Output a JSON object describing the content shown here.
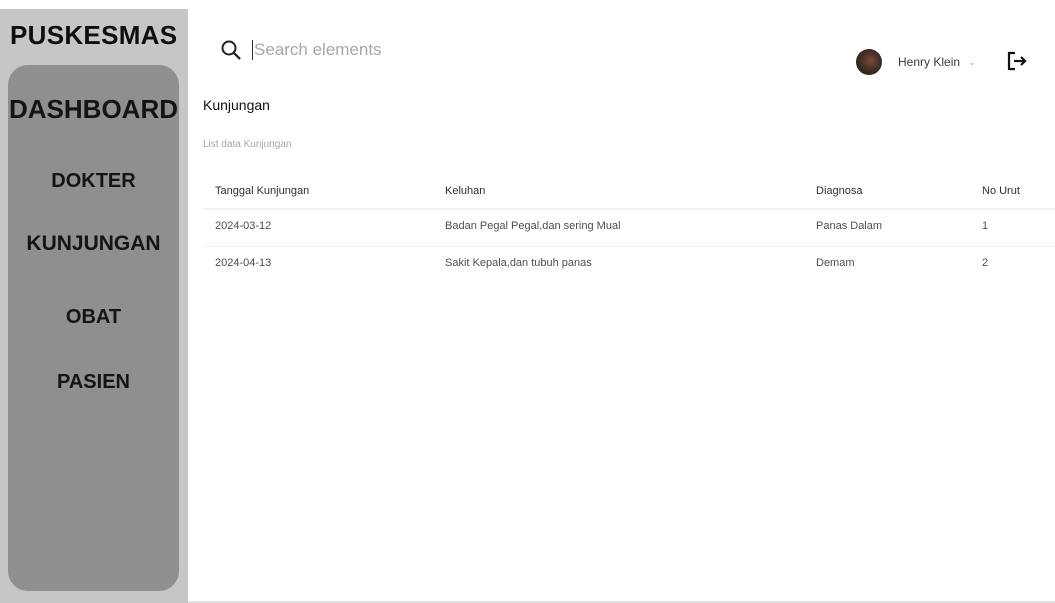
{
  "brand": "PUSKESMAS",
  "nav": {
    "dashboard": "DASHBOARD",
    "dokter": "DOKTER",
    "kunjungan": "KUNJUNGAN",
    "obat": "OBAT",
    "pasien": "PASIEN"
  },
  "search": {
    "placeholder": "Search elements",
    "icon": "search-icon"
  },
  "user": {
    "name": "Henry Klein",
    "avatar_icon": "avatar",
    "menu_icon": "chevron-down-icon",
    "logout_icon": "logout-icon"
  },
  "page": {
    "title": "Kunjungan",
    "subtitle": "List data Kunjungan"
  },
  "table": {
    "headers": [
      "Tanggal Kunjungan",
      "Keluhan",
      "Diagnosa",
      "No Urut"
    ],
    "rows": [
      [
        "2024-03-12",
        "Badan Pegal Pegal,dan sering Mual",
        "Panas Dalam",
        "1"
      ],
      [
        "2024-04-13",
        "Sakit Kepala,dan tubuh panas",
        "Demam",
        "2"
      ]
    ]
  },
  "colors": {
    "sidebar_outer": "#c6c6c6",
    "sidebar_panel": "#8f8f8f",
    "subtitle": "#a4a4ae"
  }
}
